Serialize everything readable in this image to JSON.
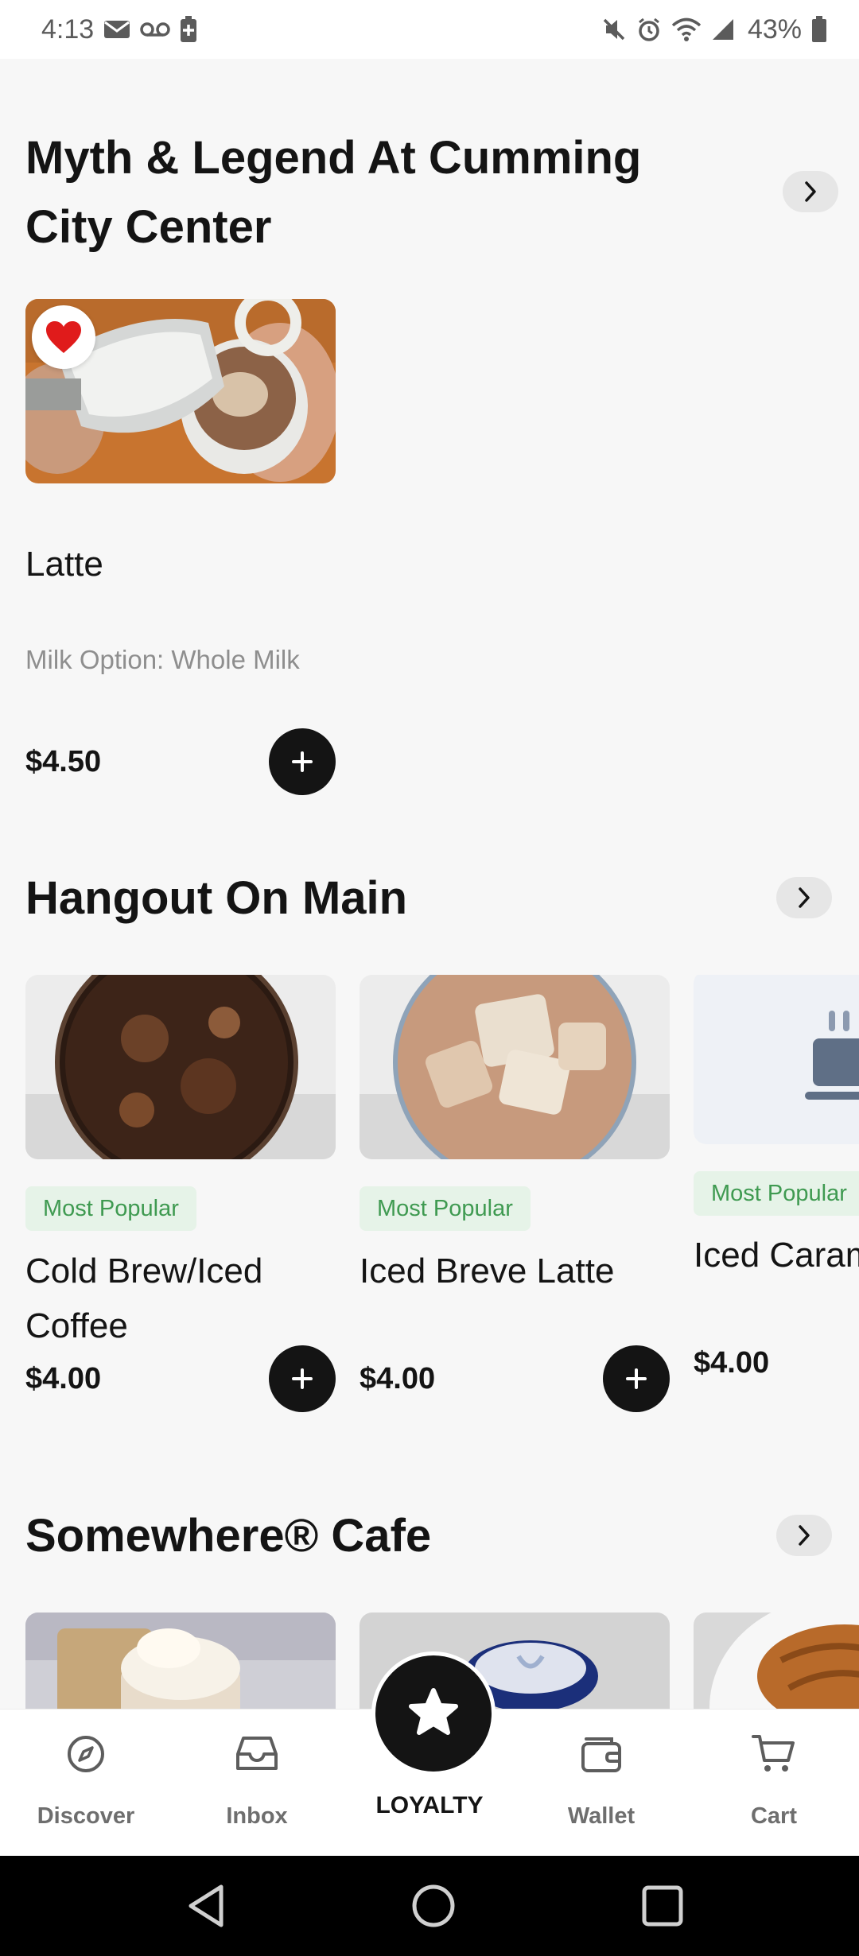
{
  "status_bar": {
    "time": "4:13",
    "battery_pct": "43%"
  },
  "sections": [
    {
      "title": "Myth & Legend At Cumming City Center",
      "items": [
        {
          "name": "Latte",
          "option": "Milk Option: Whole Milk",
          "price": "$4.50",
          "favorited": true
        }
      ]
    },
    {
      "title": "Hangout On Main",
      "items": [
        {
          "badge": "Most Popular",
          "name": "Cold Brew/Iced Coffee",
          "price": "$4.00"
        },
        {
          "badge": "Most Popular",
          "name": "Iced Breve Latte",
          "price": "$4.00"
        },
        {
          "badge": "Most Popular",
          "name": "Iced Caramel Latte",
          "price": "$4.00"
        }
      ]
    },
    {
      "title": "Somewhere® Cafe"
    }
  ],
  "bottom_nav": {
    "discover": "Discover",
    "inbox": "Inbox",
    "loyalty": "LOYALTY",
    "wallet": "Wallet",
    "cart": "Cart"
  },
  "colors": {
    "background": "#f7f7f7",
    "text_primary": "#141414",
    "badge_bg": "#e6f3e8",
    "badge_text": "#3f9a51",
    "favorite_heart": "#e01b1b"
  }
}
